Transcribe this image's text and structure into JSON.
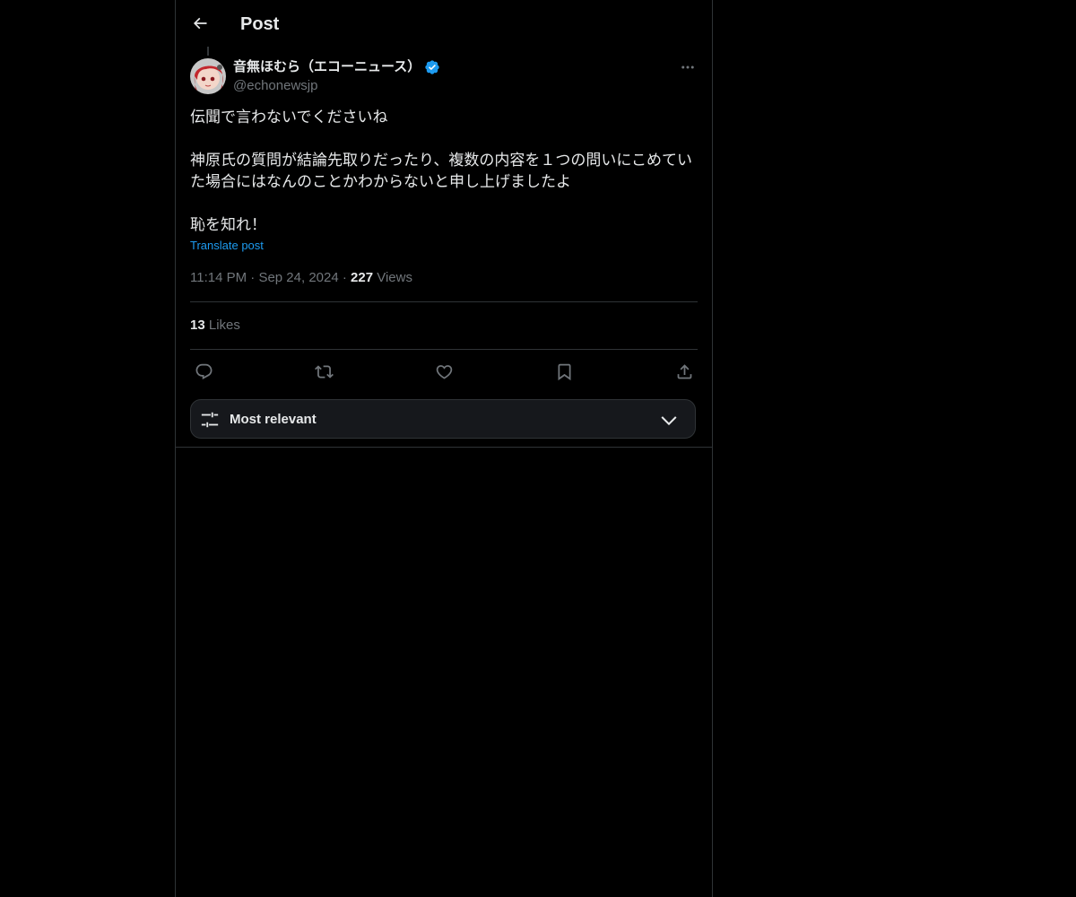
{
  "header": {
    "title": "Post",
    "back_icon": "arrow-left-icon"
  },
  "post": {
    "author": {
      "name": "音無ほむら（エコーニュース）",
      "handle": "@echonewsjp",
      "verified": true
    },
    "paragraphs": [
      "伝聞で言わないでくださいね",
      "神原氏の質問が結論先取りだったり、複数の内容を１つの問いにこめていた場合にはなんのことかわからないと申し上げましたよ",
      "恥を知れ！"
    ],
    "translate_label": "Translate post",
    "time": "11:14 PM",
    "date": "Sep 24, 2024",
    "views_count": "227",
    "views_label": "Views",
    "likes_count": "13",
    "likes_label": "Likes"
  },
  "actions": [
    "reply-icon",
    "repost-icon",
    "like-icon",
    "bookmark-icon",
    "share-icon"
  ],
  "sort": {
    "label": "Most relevant"
  },
  "colors": {
    "background": "#000000",
    "text": "#e7e9ea",
    "muted": "#71767b",
    "accent": "#1d9bf0",
    "border": "#2f3336"
  }
}
